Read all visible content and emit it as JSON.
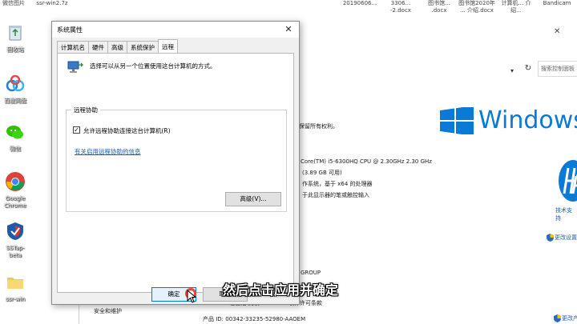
{
  "desktop": {
    "icons": [
      {
        "label": "回收站"
      },
      {
        "label": "百度网盘"
      },
      {
        "label": "微信"
      },
      {
        "label": "Google Chrome"
      },
      {
        "label": "SSTap-beta"
      },
      {
        "label": "ssr-win"
      }
    ],
    "top_files": [
      "微信图片",
      "ssr-win2.7z",
      "20190606...",
      "3306... -2.docx",
      "图书馆... .docx",
      "图书馆2020年 ... 介绍.docx",
      "计算机... 介绍...",
      "Bandicam"
    ]
  },
  "system_window": {
    "search_placeholder": "搜索控制面板",
    "copyright_text": "保留所有权利。",
    "windows_word": "Windows",
    "processor": "Core(TM) i5-6300HQ CPU @ 2.30GHz   2.30 GHz",
    "ram": "(3.89 GB 可用)",
    "system_type": "作系统，基于 x64 的处理器",
    "pen_touch": "于此显示器的笔或触控输入",
    "workgroup": "GROUP",
    "activation_text": "Windows 已激活   阅读 Microsoft 软件许可条款",
    "security_link": "安全和维护",
    "product_id": "产品 ID: 00342-33235-52980-AAOEM",
    "change_settings_1": "更改设置",
    "change_settings_2": "更改产品",
    "hp_support": "技术支持",
    "icons": [
      "windows-logo",
      "hp-logo",
      "shield-icon",
      "refresh-icon",
      "chevron-down-icon"
    ]
  },
  "dialog": {
    "title": "系统属性",
    "tabs": [
      {
        "label": "计算机名"
      },
      {
        "label": "硬件"
      },
      {
        "label": "高级"
      },
      {
        "label": "系统保护"
      },
      {
        "label": "远程"
      }
    ],
    "active_tab": "远程",
    "description": "选择可以从另一个位置使用这台计算机的方式。",
    "group_title": "远程协助",
    "allow_checkbox_label": "允许远程协助连接这台计算机(R)",
    "allow_checked": true,
    "help_link": "有关启用远程协助的信息",
    "advanced_button": "高级(V)...",
    "ok_button": "确定",
    "cancel_button": "取消"
  },
  "subtitle": "然后点击应用并确定"
}
